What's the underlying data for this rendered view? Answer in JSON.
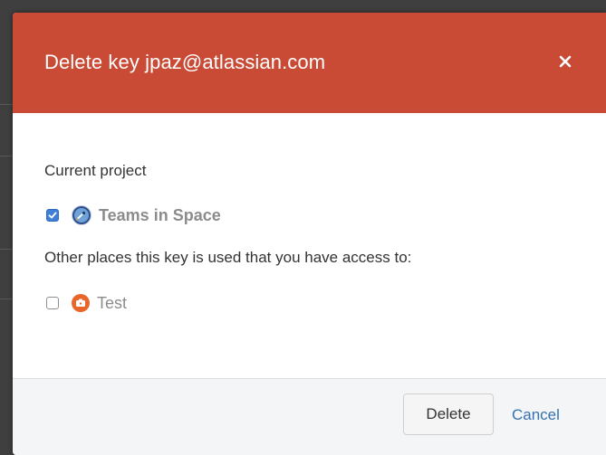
{
  "dialog": {
    "title": "Delete key jpaz@atlassian.com",
    "close_glyph": "×",
    "header_color": "#c94a35"
  },
  "current_project": {
    "label": "Current project",
    "item": {
      "name": "Teams in Space",
      "checked": true,
      "icon": "teams-in-space-avatar-icon"
    }
  },
  "other_places": {
    "label": "Other places this key is used that you have access to:",
    "items": [
      {
        "name": "Test",
        "checked": false,
        "icon": "test-avatar-icon"
      }
    ]
  },
  "footer": {
    "delete_label": "Delete",
    "cancel_label": "Cancel",
    "link_color": "#3572b0"
  }
}
